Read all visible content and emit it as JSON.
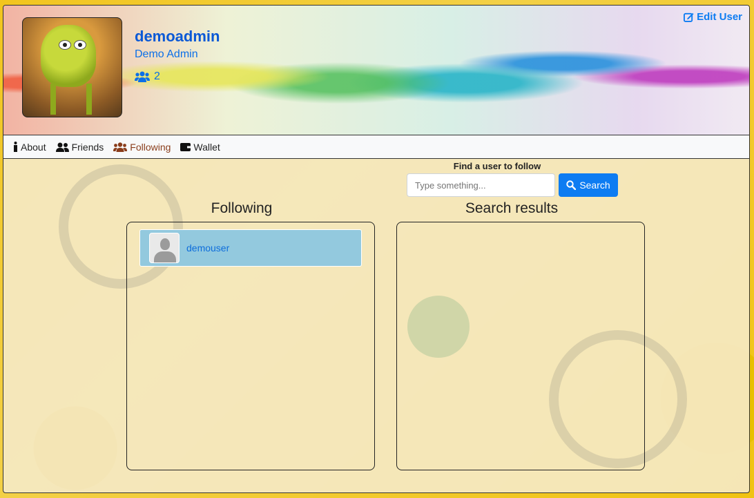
{
  "header": {
    "username": "demoadmin",
    "full_name": "Demo Admin",
    "friend_count": "2",
    "edit_label": "Edit User"
  },
  "tabs": [
    {
      "label": "About",
      "icon": "info-icon"
    },
    {
      "label": "Friends",
      "icon": "users-icon"
    },
    {
      "label": "Following",
      "icon": "user-group-icon",
      "active": true
    },
    {
      "label": "Wallet",
      "icon": "wallet-icon"
    }
  ],
  "search": {
    "title": "Find a user to follow",
    "placeholder": "Type something...",
    "button_label": "Search"
  },
  "following": {
    "title": "Following",
    "users": [
      {
        "name": "demouser"
      }
    ]
  },
  "results": {
    "title": "Search results",
    "users": []
  },
  "colors": {
    "primary": "#0d7cf2",
    "active_tab": "#8a3d1b",
    "row_bg": "#93c9de"
  }
}
